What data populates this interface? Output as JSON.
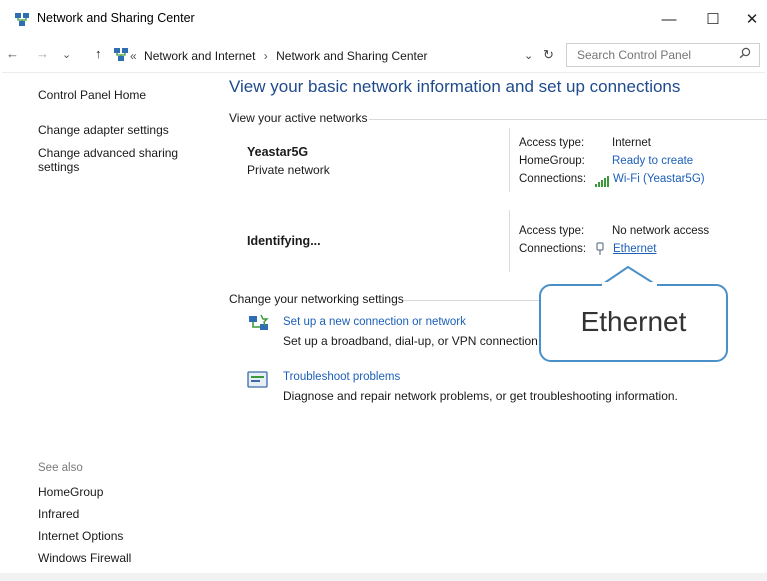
{
  "window": {
    "title": "Network and Sharing Center",
    "controls": {
      "minimize": "—",
      "maximize": "☐",
      "close": "✕"
    }
  },
  "address_bar": {
    "back": "←",
    "forward": "→",
    "recent": "⌄",
    "up": "↑",
    "overflow": "«",
    "crumbs": [
      "Network and Internet",
      "Network and Sharing Center"
    ],
    "crumb_sep": "›",
    "dropdown": "⌄",
    "refresh": "↻",
    "search_placeholder": "Search Control Panel"
  },
  "sidebar": {
    "home": "Control Panel Home",
    "links": [
      "Change adapter settings",
      "Change advanced sharing",
      "settings"
    ],
    "see_also_heading": "See also",
    "see_also": [
      "HomeGroup",
      "Infrared",
      "Internet Options",
      "Windows Firewall"
    ]
  },
  "main": {
    "title": "View your basic network information and set up connections",
    "active_heading": "View your active networks",
    "networks": [
      {
        "name": "Yeastar5G",
        "type": "Private network",
        "rows": [
          {
            "key": "Access type:",
            "value": "Internet"
          },
          {
            "key": "HomeGroup:",
            "value": "Ready to create"
          },
          {
            "key": "Connections:",
            "value": "Wi-Fi (Yeastar5G)"
          }
        ]
      },
      {
        "name": "Identifying...",
        "rows": [
          {
            "key": "Access type:",
            "value": "No network access"
          },
          {
            "key": "Connections:",
            "value": "Ethernet"
          }
        ]
      }
    ],
    "change_heading": "Change your networking settings",
    "tasks": [
      {
        "link": "Set up a new connection or network",
        "desc": "Set up a broadband, dial-up, or VPN connection; o"
      },
      {
        "link": "Troubleshoot problems",
        "desc": "Diagnose and repair network problems, or get troubleshooting information."
      }
    ]
  },
  "callout": {
    "text": "Ethernet",
    "border_color": "#4a90c8"
  },
  "colors": {
    "title_blue": "#1e4a8c",
    "link_blue": "#1c5fb8",
    "wifi_green": "#3a9a3a"
  }
}
